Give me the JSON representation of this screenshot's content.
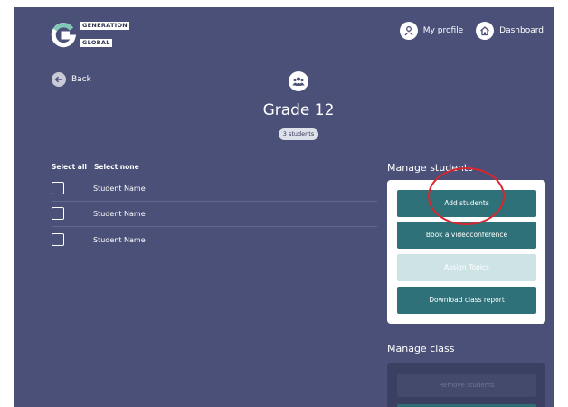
{
  "header": {
    "logo_line1": "GENERATION",
    "logo_line2": "GLOBAL",
    "nav": [
      {
        "label": "My profile",
        "icon": "person-icon"
      },
      {
        "label": "Dashboard",
        "icon": "home-icon"
      }
    ]
  },
  "back_label": "Back",
  "class": {
    "title": "Grade 12",
    "student_count": "3 students",
    "icon": "group-icon"
  },
  "selection": {
    "select_all": "Select all",
    "select_none": "Select none"
  },
  "students": [
    {
      "name": "Student Name",
      "checked": false
    },
    {
      "name": "Student Name",
      "checked": false
    },
    {
      "name": "Student Name",
      "checked": false
    }
  ],
  "manage_students": {
    "heading": "Manage students",
    "buttons": [
      {
        "label": "Add students",
        "enabled": true
      },
      {
        "label": "Book a videoconference",
        "enabled": true
      },
      {
        "label": "Assign Topics",
        "enabled": false
      },
      {
        "label": "Download class report",
        "enabled": true
      }
    ]
  },
  "manage_class": {
    "heading": "Manage class",
    "buttons": [
      {
        "label": "Remove students",
        "enabled": false
      }
    ]
  },
  "colors": {
    "background": "#4b5078",
    "primary_button": "#2f7178",
    "disabled_button": "#cde3e6",
    "annotation": "#d9262e"
  }
}
